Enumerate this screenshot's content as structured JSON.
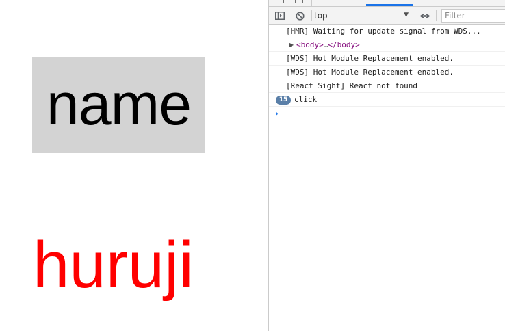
{
  "page": {
    "name_label": "name",
    "name_bg": "#d3d3d3",
    "huruji_label": "huruji",
    "huruji_color": "#ff0000"
  },
  "devtools": {
    "tab_icons": [
      "inspect-element-icon",
      "device-toolbar-icon"
    ],
    "toolbar": {
      "sidebar_icon": "console-sidebar-icon",
      "clear_icon": "clear-console-icon",
      "context": "top",
      "eye_icon": "live-expression-icon",
      "filter_placeholder": "Filter"
    },
    "accent": "#1a73e8",
    "logs": [
      {
        "text": "[HMR] Waiting for update signal from WDS..."
      },
      {
        "body_open": "<body>",
        "ellipsis": "…",
        "body_close": "</body>"
      },
      {
        "text": "[WDS] Hot Module Replacement enabled."
      },
      {
        "text": "[WDS] Hot Module Replacement enabled."
      },
      {
        "text": "[React Sight] React not found"
      },
      {
        "count": "15",
        "text": "click"
      }
    ],
    "prompt_symbol": "›"
  }
}
